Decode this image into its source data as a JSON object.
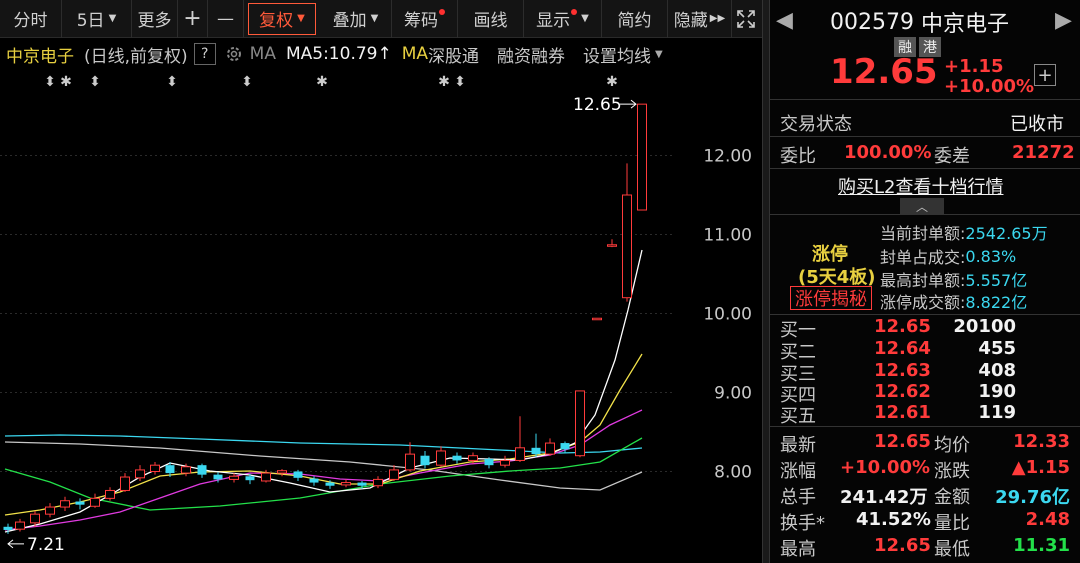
{
  "toolbar": {
    "items": [
      "分时",
      "5日",
      "更多",
      "+",
      "—",
      "复权",
      "叠加",
      "筹码",
      "画线",
      "显示",
      "简约",
      "隐藏"
    ],
    "fullscreen_icon": "expand-icon"
  },
  "infobar": {
    "stock_name": "中京电子",
    "mode": "(日线,前复权)",
    "help": "?",
    "ma_label": "MA",
    "ma5": "MA5:10.79↑",
    "ma_prefix": "MA",
    "ma_suffix": "深股通",
    "rzrq": "融资融券",
    "set_ma": "设置均线"
  },
  "chart": {
    "y_ticks": [
      "12.00",
      "11.00",
      "10.00",
      "9.00",
      "8.00"
    ],
    "high_label": "12.65",
    "low_label": "7.21",
    "colors": {
      "up": "#ff3b3b",
      "down": "#3bd8f0",
      "ma5": "#ffffff",
      "ma10": "#f2e24a",
      "ma20": "#e03ae0",
      "ma30": "#23e04a",
      "ma60": "#3bd8f0",
      "ma120": "#c8c8c8"
    }
  },
  "header": {
    "code": "002579",
    "name": "中京电子",
    "tag1": "融",
    "tag2": "港",
    "price": "12.65",
    "change": "+1.15",
    "change_pct": "+10.00%"
  },
  "status": {
    "label": "交易状态",
    "value": "已收市"
  },
  "wei": {
    "ratio_label": "委比",
    "ratio": "100.00%",
    "diff_label": "委差",
    "diff": "21272"
  },
  "l2": {
    "link": "购买L2查看十档行情"
  },
  "limit": {
    "title": "涨停",
    "days": "(5天4板)",
    "button": "涨停揭秘",
    "lines": [
      {
        "label": "当前封单额:",
        "value": "2542.65万"
      },
      {
        "label": "封单占成交:",
        "value": "0.83%"
      },
      {
        "label": "最高封单额:",
        "value": "5.557亿"
      },
      {
        "label": "涨停成交额:",
        "value": "8.822亿"
      }
    ]
  },
  "bids": [
    {
      "label": "买一",
      "price": "12.65",
      "vol": "20100"
    },
    {
      "label": "买二",
      "price": "12.64",
      "vol": "455"
    },
    {
      "label": "买三",
      "price": "12.63",
      "vol": "408"
    },
    {
      "label": "买四",
      "price": "12.62",
      "vol": "190"
    },
    {
      "label": "买五",
      "price": "12.61",
      "vol": "119"
    }
  ],
  "stats": [
    {
      "l1": "最新",
      "v1": "12.65",
      "l2": "均价",
      "v2": "12.33"
    },
    {
      "l1": "涨幅",
      "v1": "+10.00%",
      "l2": "涨跌",
      "v2": "▲1.15"
    },
    {
      "l1": "总手",
      "v1": "241.42万",
      "l2": "金额",
      "v2": "29.76亿"
    },
    {
      "l1": "换手*",
      "v1": "41.52%",
      "l2": "量比",
      "v2": "2.48"
    },
    {
      "l1": "最高",
      "v1": "12.65",
      "l2": "最低",
      "v2": "11.31"
    }
  ]
}
